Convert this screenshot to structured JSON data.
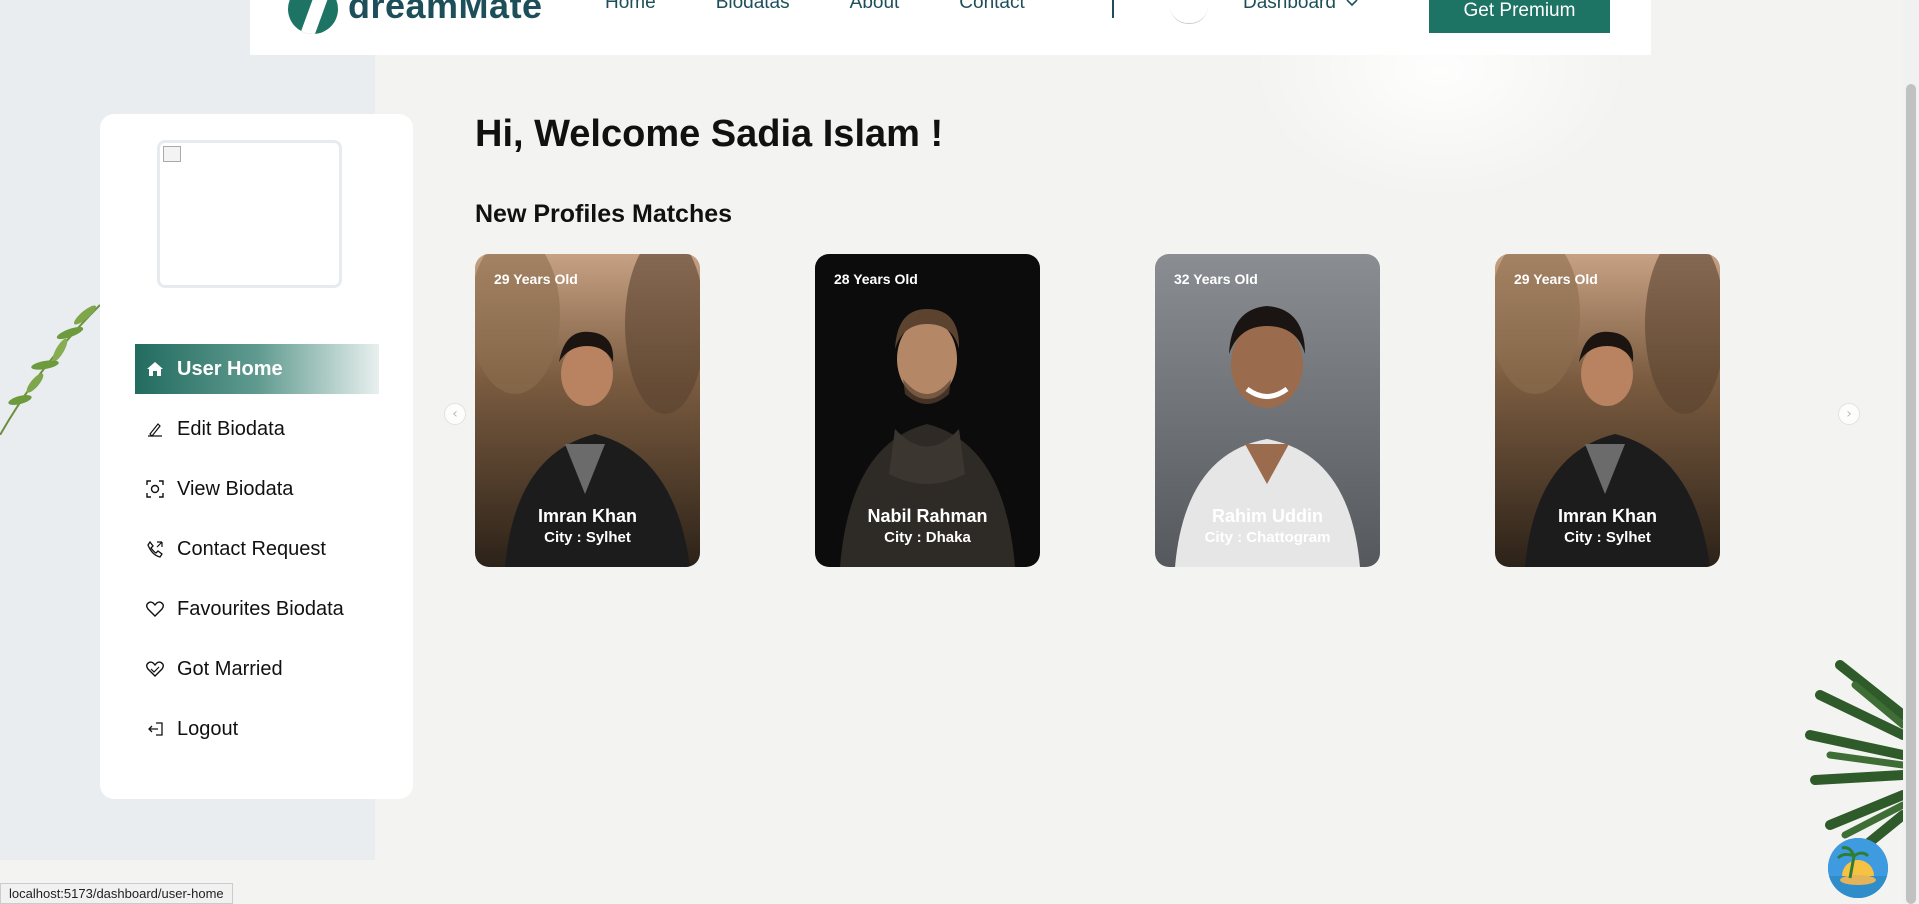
{
  "nav": {
    "logo_text": "dreamMate",
    "links": [
      "Home",
      "Biodatas",
      "About",
      "Contact"
    ],
    "dashboard_label": "Dashboard",
    "premium_label": "Get Premium"
  },
  "sidebar": {
    "items": [
      {
        "label": "User Home",
        "icon": "home-icon",
        "active": true
      },
      {
        "label": "Edit Biodata",
        "icon": "pen-icon"
      },
      {
        "label": "View Biodata",
        "icon": "view-icon"
      },
      {
        "label": "Contact Request",
        "icon": "phone-icon"
      },
      {
        "label": "Favourites Biodata",
        "icon": "heart-icon"
      },
      {
        "label": "Got Married",
        "icon": "heart-hands-icon"
      },
      {
        "label": "Logout",
        "icon": "logout-icon"
      }
    ]
  },
  "main": {
    "welcome": "Hi, Welcome Sadia Islam !",
    "section_title": "New Profiles Matches",
    "profiles": [
      {
        "age": "29 Years Old",
        "name": "Imran Khan",
        "city": "City : Sylhet"
      },
      {
        "age": "28 Years Old",
        "name": "Nabil Rahman",
        "city": "City : Dhaka"
      },
      {
        "age": "32 Years Old",
        "name": "Rahim Uddin",
        "city": "City : Chattogram"
      },
      {
        "age": "29 Years Old",
        "name": "Imran Khan",
        "city": "City : Sylhet"
      }
    ]
  },
  "status_url": "localhost:5173/dashboard/user-home",
  "colors": {
    "brand": "#1e7464",
    "brand_dark": "#1d4f5a"
  }
}
